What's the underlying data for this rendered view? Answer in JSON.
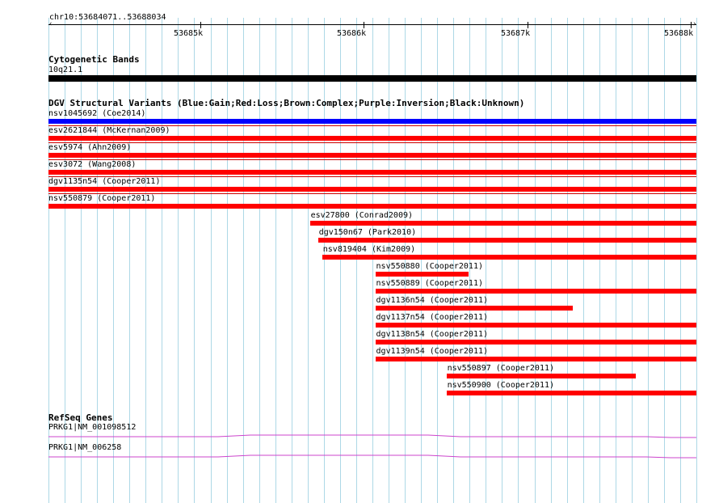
{
  "colors": {
    "gain": "#0000ff",
    "loss": "#ff0000",
    "band": "#000000",
    "grid": "#add8e6",
    "gene": "#cc44cc",
    "separator": "#cc0000"
  },
  "header": {
    "location": "chr10:53684071..53688034"
  },
  "scale": {
    "start": 53684071,
    "end": 53688034,
    "ticks": [
      {
        "pos": 53685000,
        "label": "53685k"
      },
      {
        "pos": 53686000,
        "label": "53686k"
      },
      {
        "pos": 53687000,
        "label": "53687k"
      },
      {
        "pos": 53688000,
        "label": "53688k"
      }
    ]
  },
  "cytobands": {
    "title": "Cytogenetic Bands",
    "band": {
      "name": "10q21.1",
      "start": 53684071,
      "end": 53688034
    }
  },
  "dgv": {
    "title": "DGV Structural Variants (Blue:Gain;Red:Loss;Brown:Complex;Purple:Inversion;Black:Unknown)",
    "variants": [
      {
        "label": "nsv1045692 (Coe2014)",
        "type": "gain",
        "start": 53684071,
        "end": 53688034
      },
      {
        "label": "esv2621844 (McKernan2009)",
        "type": "loss",
        "start": 53684071,
        "end": 53688034
      },
      {
        "label": "esv5974 (Ahn2009)",
        "type": "loss",
        "start": 53684071,
        "end": 53688034
      },
      {
        "label": "esv3072 (Wang2008)",
        "type": "loss",
        "start": 53684071,
        "end": 53688034
      },
      {
        "label": "dgv1135n54 (Cooper2011)",
        "type": "loss",
        "start": 53684071,
        "end": 53688034
      },
      {
        "label": "nsv550879 (Cooper2011)",
        "type": "loss",
        "start": 53684071,
        "end": 53688034
      },
      {
        "label": "esv27800 (Conrad2009)",
        "type": "loss",
        "start": 53685670,
        "end": 53688034
      },
      {
        "label": "dgv150n67 (Park2010)",
        "type": "loss",
        "start": 53685720,
        "end": 53688034
      },
      {
        "label": "nsv819404 (Kim2009)",
        "type": "loss",
        "start": 53685745,
        "end": 53688034
      },
      {
        "label": "nsv550880 (Cooper2011)",
        "type": "loss",
        "start": 53686070,
        "end": 53686640
      },
      {
        "label": "nsv550889 (Cooper2011)",
        "type": "loss",
        "start": 53686070,
        "end": 53688034
      },
      {
        "label": "dgv1136n54 (Cooper2011)",
        "type": "loss",
        "start": 53686070,
        "end": 53687280
      },
      {
        "label": "dgv1137n54 (Cooper2011)",
        "type": "loss",
        "start": 53686070,
        "end": 53688034
      },
      {
        "label": "dgv1138n54 (Cooper2011)",
        "type": "loss",
        "start": 53686070,
        "end": 53688034
      },
      {
        "label": "dgv1139n54 (Cooper2011)",
        "type": "loss",
        "start": 53686070,
        "end": 53688034
      },
      {
        "label": "nsv550897 (Cooper2011)",
        "type": "loss",
        "start": 53686505,
        "end": 53687665
      },
      {
        "label": "nsv550900 (Cooper2011)",
        "type": "loss",
        "start": 53686505,
        "end": 53688034
      }
    ]
  },
  "refseq": {
    "title": "RefSeq Genes",
    "genes": [
      {
        "label": "PRKG1|NM_001098512"
      },
      {
        "label": "PRKG1|NM_006258"
      }
    ]
  }
}
